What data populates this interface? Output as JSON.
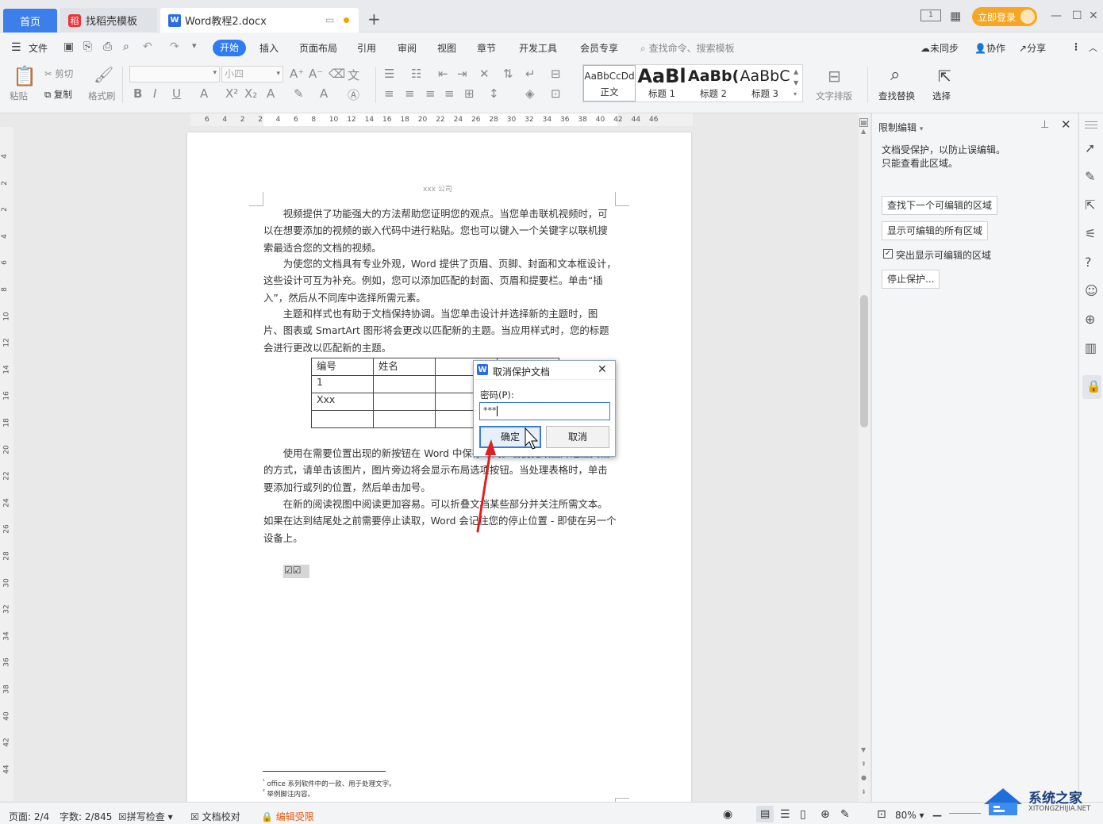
{
  "tabs": {
    "home": "首页",
    "template": "找稻壳模板",
    "document": "Word教程2.docx",
    "add": "+"
  },
  "window": {
    "login": "立即登录",
    "minimize": "—",
    "maximize": "☐",
    "close": "✕"
  },
  "menu": {
    "file": "文件",
    "start": "开始",
    "insert": "插入",
    "layout": "页面布局",
    "reference": "引用",
    "review": "审阅",
    "view": "视图",
    "chapter": "章节",
    "devtools": "开发工具",
    "member": "会员专享",
    "search": "查找命令、搜索模板",
    "sync": "未同步",
    "collab": "协作",
    "share": "分享"
  },
  "ribbon": {
    "paste": "粘贴",
    "cut": "剪切",
    "copy": "复制",
    "format_painter": "格式刷",
    "font_name": "",
    "font_size": "小四",
    "styles": [
      {
        "preview": "AaBbCcDd",
        "label": "正文"
      },
      {
        "preview": "AaBl",
        "label": "标题 1"
      },
      {
        "preview": "AaBb(",
        "label": "标题 2"
      },
      {
        "preview": "AaBbC",
        "label": "标题 3"
      }
    ],
    "text_layout": "文字排版",
    "find_replace": "查找替换",
    "select": "选择"
  },
  "ruler_ticks": [
    "6",
    "4",
    "2",
    "2",
    "4",
    "6",
    "8",
    "10",
    "12",
    "14",
    "16",
    "18",
    "20",
    "22",
    "24",
    "26",
    "28",
    "30",
    "32",
    "34",
    "36",
    "38",
    "40",
    "42",
    "44",
    "46"
  ],
  "vruler_ticks": [
    "4",
    "2",
    "2",
    "4",
    "6",
    "8",
    "10",
    "12",
    "14",
    "16",
    "18",
    "20",
    "22",
    "24",
    "26",
    "28",
    "30",
    "32",
    "34",
    "36",
    "38",
    "40",
    "42",
    "44"
  ],
  "document": {
    "header": "xxx 公司",
    "paragraphs": [
      "视频提供了功能强大的方法帮助您证明您的观点。当您单击联机视频时，可以在想要添加的视频的嵌入代码中进行粘贴。您也可以键入一个关键字以联机搜索最适合您的文档的视频。",
      "为使您的文档具有专业外观，Word 提供了页眉、页脚、封面和文本框设计，这些设计可互为补充。例如，您可以添加匹配的封面、页眉和提要栏。单击“插入”，然后从不同库中选择所需元素。",
      "主题和样式也有助于文档保持协调。当您单击设计并选择新的主题时，图片、图表或 SmartArt 图形将会更改以匹配新的主题。当应用样式时，您的标题会进行更改以匹配新的主题。",
      "使用在需要位置出现的新按钮在 Word 中保存时间。若要更改图片适应文档的方式，请单击该图片，图片旁边将会显示布局选项按钮。当处理表格时，单击要添加行或列的位置，然后单击加号。",
      "在新的阅读视图中阅读更加容易。可以折叠文档某些部分并关注所需文本。如果在达到结尾处之前需要停止读取，Word 会记住您的停止位置 - 即使在另一个设备上。"
    ],
    "table": [
      [
        "编号",
        "姓名",
        "",
        ""
      ],
      [
        "1",
        "",
        "",
        ""
      ],
      [
        "Xxx",
        "",
        "",
        ""
      ],
      [
        "",
        "",
        "",
        ""
      ]
    ],
    "checkboxes": "☑☑",
    "footnotes": [
      "office 系列软件中的一款、用于处理文字。",
      "举例脚注内容。"
    ]
  },
  "dialog": {
    "title": "取消保护文档",
    "label": "密码(P):",
    "value": "***",
    "ok": "确定",
    "cancel": "取消"
  },
  "panel": {
    "title": "限制编辑",
    "desc1": "文档受保护，以防止误编辑。",
    "desc2": "只能查看此区域。",
    "find_next": "查找下一个可编辑的区域",
    "show_all": "显示可编辑的所有区域",
    "highlight": "突出显示可编辑的区域",
    "stop": "停止保护..."
  },
  "status": {
    "page": "页面: 2/4",
    "words": "字数: 2/845",
    "spell": "拼写检查",
    "proof": "文档校对",
    "restricted": "编辑受限",
    "zoom": "80%"
  },
  "watermark": {
    "name": "系统之家",
    "url": "XITONGZHIJIA.NET"
  },
  "colors": {
    "accent": "#2f7bf3",
    "restricted": "#e8590c",
    "arrow": "#e02020"
  }
}
